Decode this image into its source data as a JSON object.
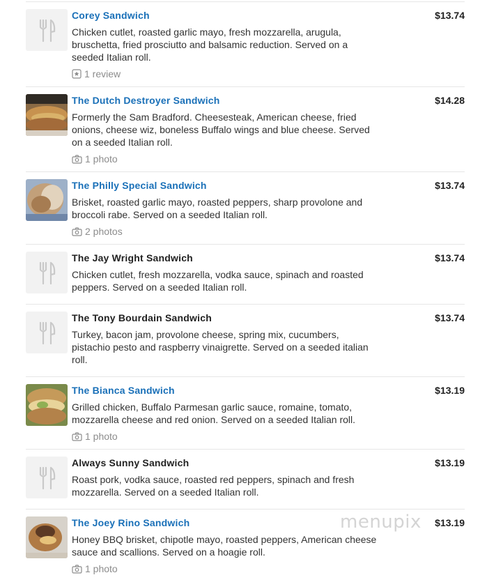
{
  "menu": {
    "items": [
      {
        "name": "Corey Sandwich",
        "linked": true,
        "image": "utensils-placeholder-icon",
        "description": "Chicken cutlet, roasted garlic mayo, fresh mozzarella, arugula, bruschetta, fried prosciutto and balsamic reduction. Served on a seeded Italian roll.",
        "price": "$13.74",
        "meta": "1 review",
        "meta_icon": "review-star-icon"
      },
      {
        "name": "The Dutch Destroyer Sandwich",
        "linked": true,
        "image": "sandwich-photo",
        "description": "Formerly the Sam Bradford. Cheesesteak, American cheese, fried onions, cheese wiz, boneless Buffalo wings and blue cheese. Served on a seeded Italian roll.",
        "price": "$14.28",
        "meta": "1 photo",
        "meta_icon": "camera-icon"
      },
      {
        "name": "The Philly Special Sandwich",
        "linked": true,
        "image": "sandwich-photo",
        "description": "Brisket, roasted garlic mayo, roasted peppers, sharp provolone and broccoli rabe. Served on a seeded Italian roll.",
        "price": "$13.74",
        "meta": "2 photos",
        "meta_icon": "camera-icon"
      },
      {
        "name": "The Jay Wright Sandwich",
        "linked": false,
        "image": "utensils-placeholder-icon",
        "description": "Chicken cutlet, fresh mozzarella, vodka sauce, spinach and roasted peppers. Served on a seeded Italian roll.",
        "price": "$13.74",
        "meta": "",
        "meta_icon": ""
      },
      {
        "name": "The Tony Bourdain Sandwich",
        "linked": false,
        "image": "utensils-placeholder-icon",
        "description": "Turkey, bacon jam, provolone cheese, spring mix, cucumbers, pistachio pesto and raspberry vinaigrette. Served on a seeded italian roll.",
        "price": "$13.74",
        "meta": "",
        "meta_icon": ""
      },
      {
        "name": "The Bianca Sandwich",
        "linked": true,
        "image": "sandwich-photo",
        "description": "Grilled chicken, Buffalo Parmesan garlic sauce, romaine, tomato, mozzarella cheese and red onion. Served on a seeded Italian roll.",
        "price": "$13.19",
        "meta": "1 photo",
        "meta_icon": "camera-icon"
      },
      {
        "name": "Always Sunny Sandwich",
        "linked": false,
        "image": "utensils-placeholder-icon",
        "description": "Roast pork, vodka sauce, roasted red peppers, spinach and fresh mozzarella. Served on a seeded Italian roll.",
        "price": "$13.19",
        "meta": "",
        "meta_icon": ""
      },
      {
        "name": "The Joey Rino Sandwich",
        "linked": true,
        "image": "sandwich-photo",
        "description": "Honey BBQ brisket, chipotle mayo, roasted peppers, American cheese sauce and scallions. Served on a hoagie roll.",
        "price": "$13.19",
        "meta": "1 photo",
        "meta_icon": "camera-icon"
      }
    ]
  },
  "watermark": "menupix",
  "colors": {
    "link": "#1a70b8",
    "divider": "#e6e6e6",
    "muted": "#8c8c8c"
  }
}
